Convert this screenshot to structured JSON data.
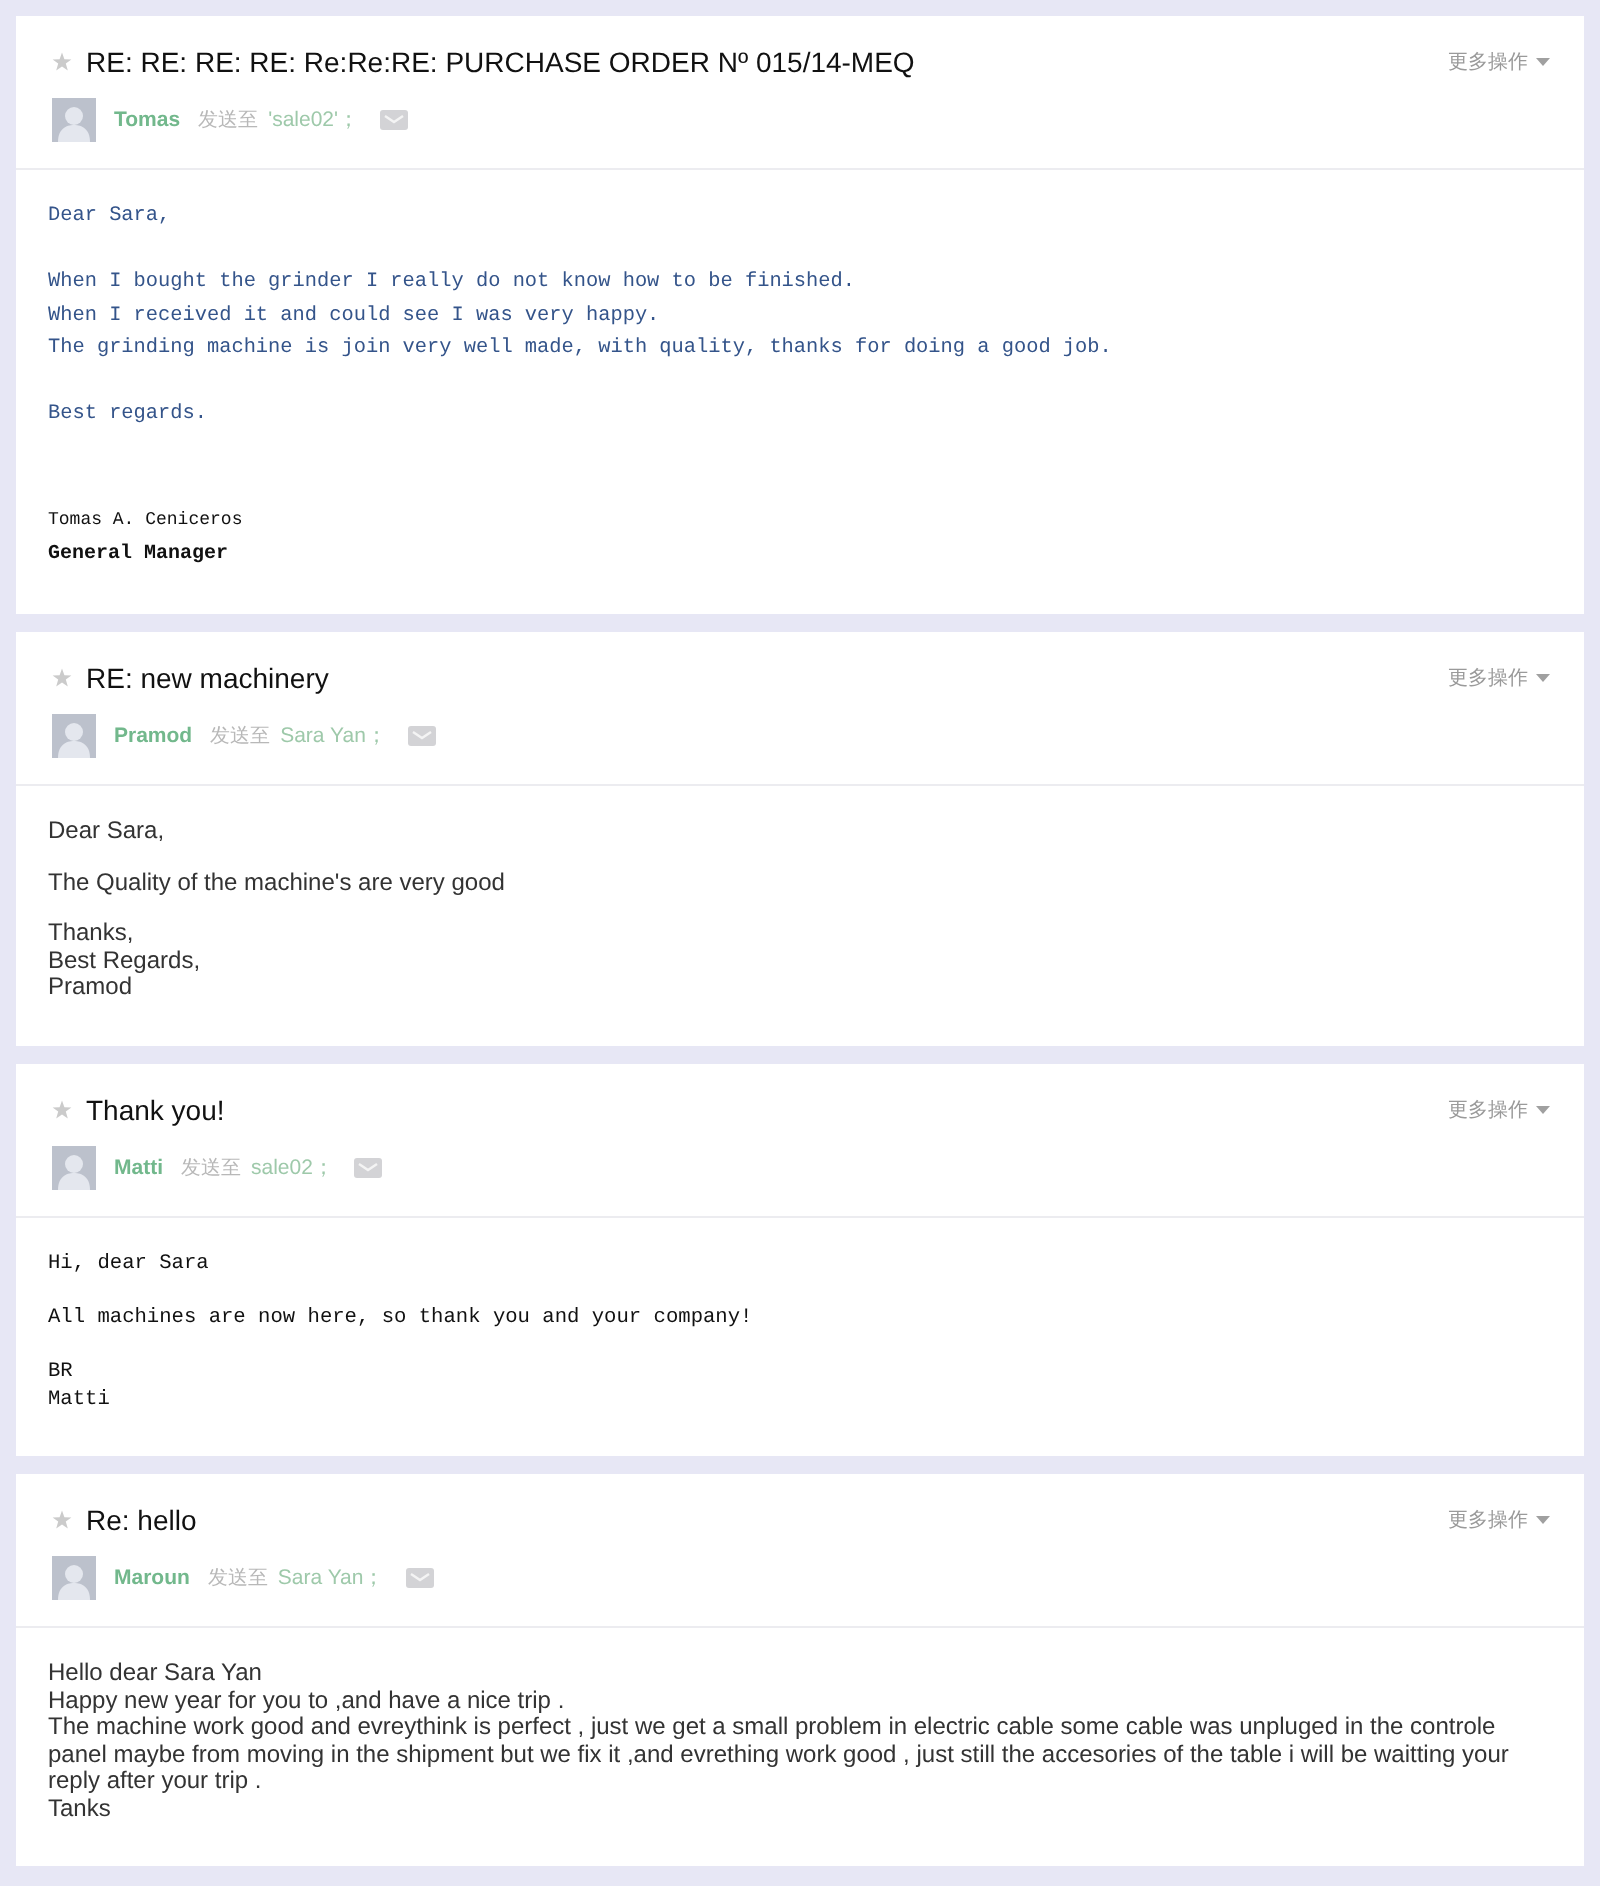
{
  "emails": [
    {
      "kind": "mono-blue",
      "starred": false,
      "subject": "RE: RE: RE: RE: Re:Re:RE: PURCHASE ORDER Nº 015/14-MEQ",
      "sender": "Tomas",
      "sent_to": "发送至",
      "recipient": "'sale02'；",
      "more_actions": "更多操作",
      "paragraphs": [
        [
          "Dear Sara,"
        ],
        [
          "When I bought the grinder I really do not know how to be finished.",
          "When I received it and could see I was very happy.",
          "The grinding machine is join very well made, with quality, thanks for doing a good job."
        ],
        [
          "Best regards."
        ]
      ],
      "signature": {
        "name": "Tomas A. Ceniceros",
        "title": "General Manager"
      }
    },
    {
      "kind": "sans",
      "starred": false,
      "subject": "RE: new machinery",
      "sender": "Pramod",
      "sent_to": "发送至",
      "recipient": "Sara Yan；",
      "more_actions": "更多操作",
      "paragraphs": [
        [
          "Dear Sara,"
        ],
        [
          "The Quality of the machine's are very good"
        ],
        [
          "Thanks,",
          "Best Regards,",
          "Pramod"
        ]
      ]
    },
    {
      "kind": "mono",
      "starred": false,
      "subject": "Thank you!",
      "sender": "Matti",
      "sent_to": "发送至",
      "recipient": "sale02；",
      "more_actions": "更多操作",
      "paragraphs": [
        [
          "Hi, dear Sara"
        ],
        [
          "All machines are now here, so thank you and your company!"
        ],
        [
          "BR",
          "Matti"
        ]
      ]
    },
    {
      "kind": "sans",
      "starred": false,
      "subject": "Re: hello",
      "sender": "Maroun",
      "sent_to": "发送至",
      "recipient": "Sara Yan；",
      "more_actions": "更多操作",
      "paragraphs": [
        [
          "Hello dear Sara Yan",
          "Happy new year for you to ,and have a nice trip .",
          "The machine work good and evreythink is perfect , just we get a small problem in electric cable some cable was unpluged in the controle panel maybe from moving in the shipment but we fix it ,and evrething work good , just still the accesories of the table i will be waitting your reply after your trip .",
          "Tanks"
        ]
      ]
    }
  ]
}
